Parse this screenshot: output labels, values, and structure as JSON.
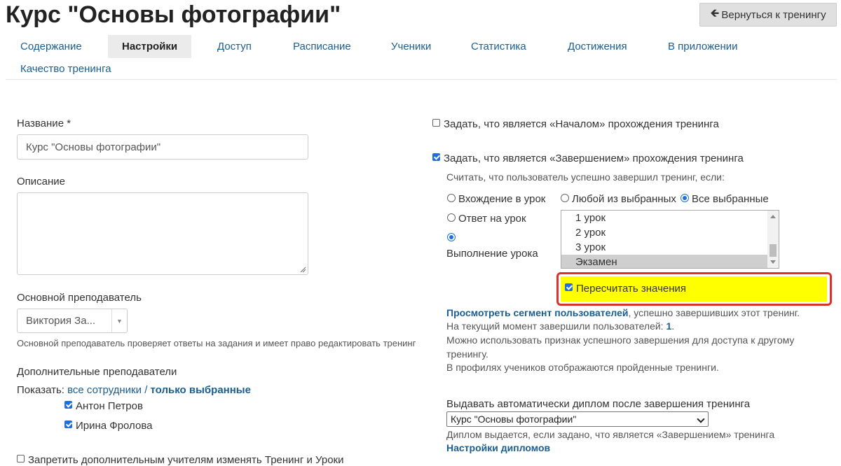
{
  "page": {
    "title": "Курс \"Основы фотографии\"",
    "back_button": "Вернуться к тренингу"
  },
  "tabs": [
    {
      "label": "Содержание"
    },
    {
      "label": "Настройки",
      "active": true
    },
    {
      "label": "Доступ"
    },
    {
      "label": "Расписание"
    },
    {
      "label": "Ученики"
    },
    {
      "label": "Статистика"
    },
    {
      "label": "Достижения"
    },
    {
      "label": "В приложении"
    },
    {
      "label": "Качество тренинга"
    }
  ],
  "left": {
    "name_label": "Название *",
    "name_value": "Курс \"Основы фотографии\"",
    "description_label": "Описание",
    "description_value": "",
    "teacher_label": "Основной преподаватель",
    "teacher_value": "Виктория За...",
    "teacher_hint": "Основной преподаватель проверяет ответы на задания и имеет право редактировать тренинг",
    "extra_teachers_label": "Дополнительные преподаватели",
    "show_prefix": "Показать:",
    "show_all": "все сотрудники",
    "show_sep": "/",
    "show_selected": "только выбранные",
    "teachers": [
      {
        "name": "Антон Петров",
        "checked": true
      },
      {
        "name": "Ирина Фролова",
        "checked": true
      }
    ],
    "forbid_label": "Запретить дополнительным учителям изменять Тренинг и Уроки"
  },
  "right": {
    "start_label": "Задать, что является «Началом» прохождения тренинга",
    "start_checked": false,
    "finish_label": "Задать, что является «Завершением» прохождения тренинга",
    "finish_checked": true,
    "finish_hint": "Считать, что пользователь успешно завершил тренинг, если:",
    "radio_enter": "Вхождение в урок",
    "radio_answer": "Ответ на урок",
    "radio_complete": "Выполнение урока",
    "radio_any": "Любой из выбранных",
    "radio_all": "Все выбранные",
    "lessons": [
      "1 урок",
      "2 урок",
      "3 урок",
      "Экзамен"
    ],
    "selected_lesson": "Экзамен",
    "recalc_label": "Пересчитать значения",
    "recalc_checked": true,
    "segment_link": "Просмотреть сегмент пользователей",
    "segment_text": ", успешно завершивших этот тренинг.",
    "current_prefix": "На текущий момент завершили пользователей:",
    "current_count": "1",
    "current_suffix": ".",
    "info_line1": "Можно использовать признак успешного завершения для доступа к другому",
    "info_line2": "тренингу.",
    "info_line3": "В профилях учеников отображаются пройденные тренинги.",
    "diploma_label": "Выдавать автоматически диплом после завершения тренинга",
    "diploma_value": "Курс \"Основы фотографии\"",
    "diploma_hint": "Диплом выдается, если задано, что является «Завершением» тренинга",
    "diploma_settings_link": "Настройки дипломов"
  },
  "colors": {
    "link": "#1a5d8f",
    "highlight": "#ffff00",
    "highlight_border": "#d9342b",
    "accent": "#1e6fd9"
  }
}
